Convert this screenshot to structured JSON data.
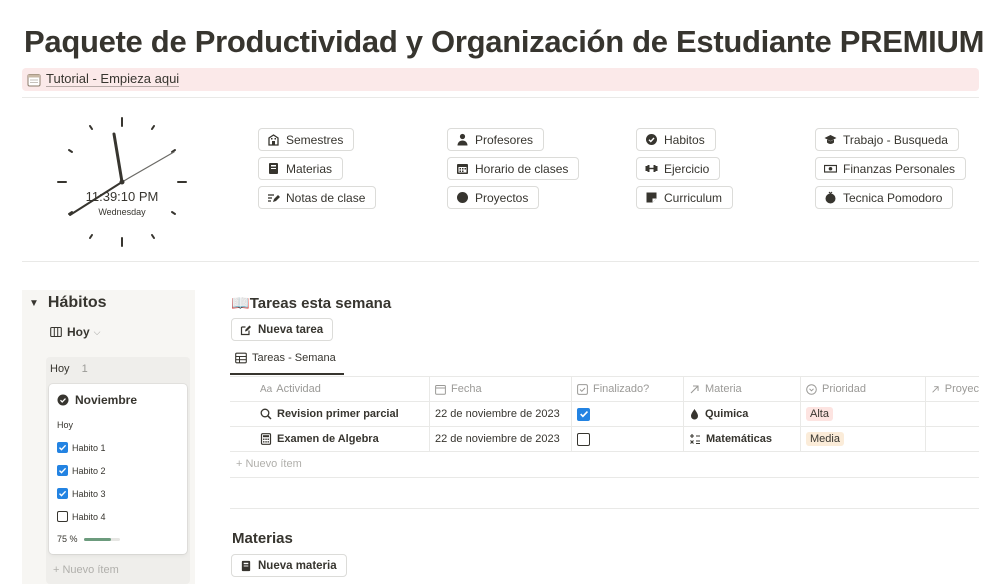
{
  "page": {
    "title": "Paquete de Productividad y Organización de Estudiante PREMIUM",
    "tutorial_link": "Tutorial - Empieza aqui"
  },
  "clock": {
    "time": "11:39:10 PM",
    "day": "Wednesday"
  },
  "nav": {
    "col1": [
      {
        "label": "Semestres",
        "icon": "building-icon"
      },
      {
        "label": "Materias",
        "icon": "notebook-icon"
      },
      {
        "label": "Notas de clase",
        "icon": "pencil-lines-icon"
      }
    ],
    "col2": [
      {
        "label": "Profesores",
        "icon": "person-icon"
      },
      {
        "label": "Horario de clases",
        "icon": "calendar-icon"
      },
      {
        "label": "Proyectos",
        "icon": "circle-icon"
      }
    ],
    "col3": [
      {
        "label": "Habitos",
        "icon": "check-circle-icon"
      },
      {
        "label": "Ejercicio",
        "icon": "dumbbell-icon"
      },
      {
        "label": "Curriculum",
        "icon": "note-icon"
      }
    ],
    "col4": [
      {
        "label": "Trabajo - Busqueda",
        "icon": "graduation-cap-icon"
      },
      {
        "label": "Finanzas Personales",
        "icon": "money-icon"
      },
      {
        "label": "Tecnica Pomodoro",
        "icon": "tomato-icon"
      }
    ]
  },
  "habits": {
    "title": "Hábitos",
    "view": "Hoy",
    "group": {
      "name": "Hoy",
      "count": "1"
    },
    "card": {
      "title": "Noviembre",
      "subtitle": "Hoy",
      "items": [
        {
          "label": "Habito 1",
          "checked": true
        },
        {
          "label": "Habito 2",
          "checked": true
        },
        {
          "label": "Habito 3",
          "checked": true
        },
        {
          "label": "Habito 4",
          "checked": false
        }
      ],
      "progress_label": "75 %",
      "progress": 0.75
    },
    "add_label": "Nuevo ítem"
  },
  "tasks": {
    "emoji": "📖",
    "title": "Tareas esta semana",
    "new_button": "Nueva tarea",
    "tab": "Tareas - Semana",
    "columns": [
      "Actividad",
      "Fecha",
      "Finalizado?",
      "Materia",
      "Prioridad",
      "Proyec"
    ],
    "rows": [
      {
        "actividad": "Revision primer parcial",
        "fecha": "22 de noviembre de 2023",
        "finalizado": true,
        "materia": "Quimica",
        "prioridad": "Alta",
        "prioridad_color": "#fde4e1"
      },
      {
        "actividad": "Examen de Algebra",
        "fecha": "22 de noviembre de 2023",
        "finalizado": false,
        "materia": "Matemáticas",
        "prioridad": "Media",
        "prioridad_color": "#fbecd9"
      }
    ],
    "add_label": "Nuevo ítem"
  },
  "materias": {
    "title": "Materias",
    "new_button": "Nueva materia"
  },
  "colors": {
    "accent": "#2383e2",
    "callout_bg": "#fbe9e9",
    "progress": "#6c9b7d"
  }
}
